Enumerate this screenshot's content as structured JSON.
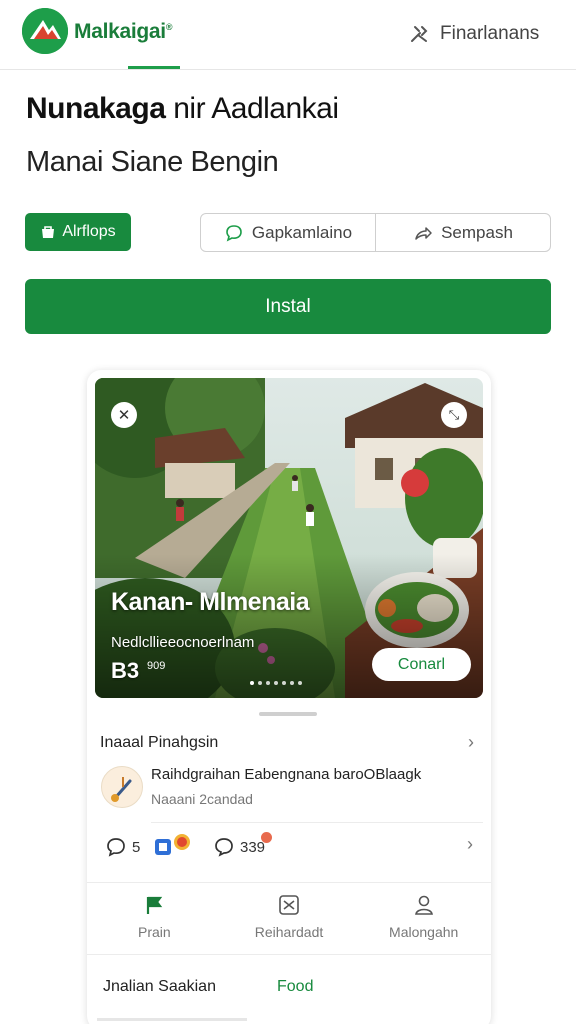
{
  "header": {
    "brand": "Malkaigai",
    "brand_sup": "®",
    "settings_label": "Finarlanans"
  },
  "hero_text": {
    "title_bold": "Nunakaga",
    "title_rest": " nir Aadlankai",
    "subtitle": "Manai Siane Bengin"
  },
  "actions": {
    "apps_label": "Alrflops",
    "segment_left": "Gapkamlaino",
    "segment_right": "Sempash",
    "install_label": "Instal"
  },
  "card": {
    "hero": {
      "title": "Kanan- Mlmenaia",
      "subtitle": "Nedlcllieeocnoerlnam",
      "rating": "B3",
      "rating_small": "909",
      "cta": "Conarl",
      "page_count": 7
    },
    "section_title": "Inaaal Pinahgsin",
    "post": {
      "title": "Raihdgraihan Eabengnana baroOBlaagk",
      "meta": "Naaani 2candad"
    },
    "reactions": {
      "comments": "5",
      "replies": "339"
    },
    "nav": [
      {
        "label": "Prain",
        "icon": "flag-icon"
      },
      {
        "label": "Reihardadt",
        "icon": "swap-icon"
      },
      {
        "label": "Malongahn",
        "icon": "person-icon"
      }
    ],
    "bottom_tabs": {
      "left": "Jnalian Saakian",
      "right": "Food"
    }
  },
  "colors": {
    "accent": "#188a3e",
    "brand": "#1a7d3a",
    "badge": "#e86a4d"
  }
}
